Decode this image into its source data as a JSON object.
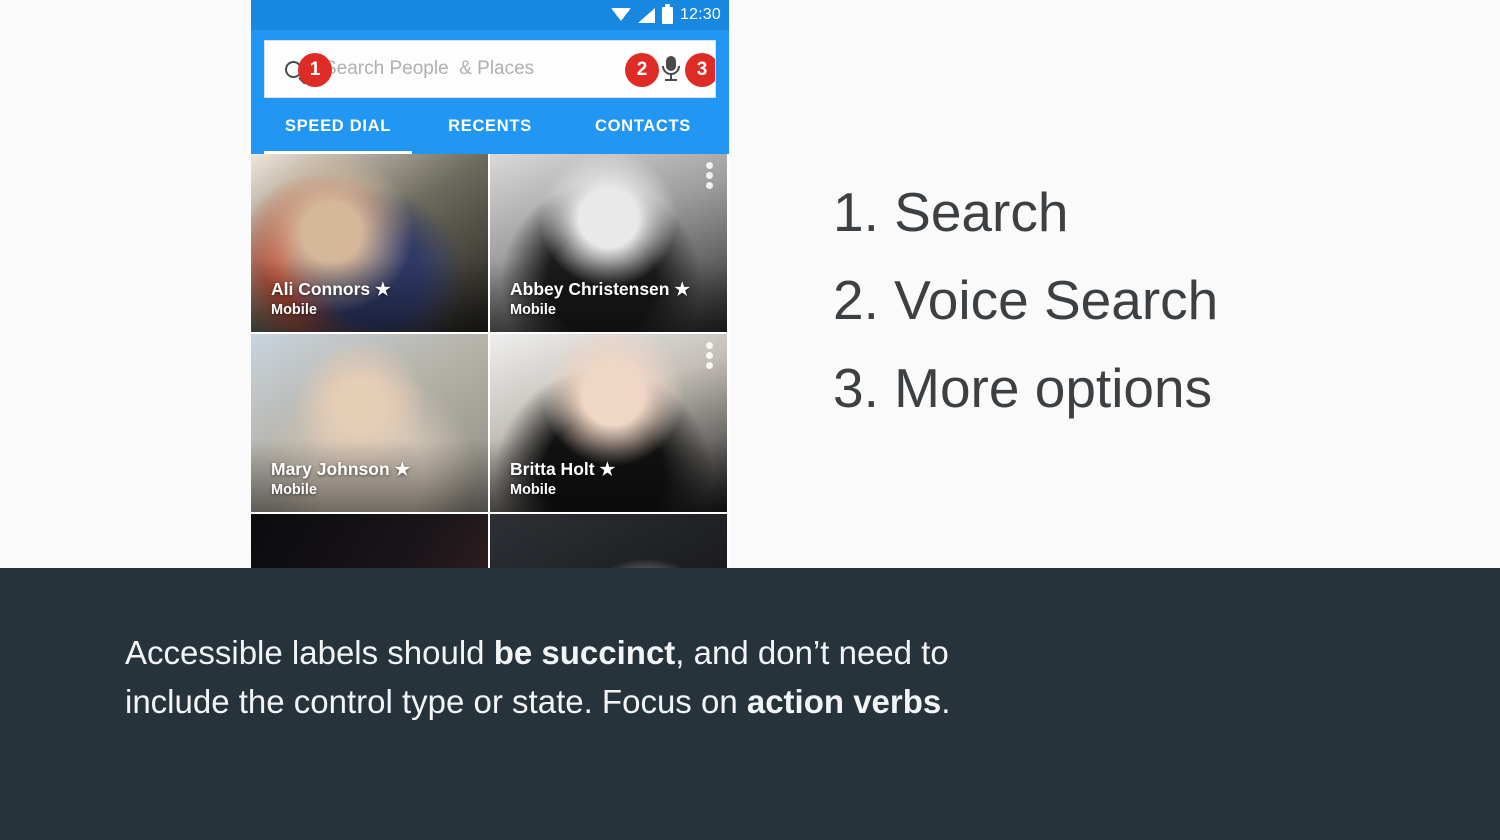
{
  "page": {
    "background_color": "#fafafa"
  },
  "phone": {
    "status_bar": {
      "time": "12:30",
      "icons": [
        "wifi-icon",
        "cellular-signal-icon",
        "battery-icon"
      ],
      "background_color": "#1787e0"
    },
    "search": {
      "placeholder": "Search People  & Places",
      "search_icon": "search-icon",
      "voice_icon": "microphone-icon",
      "overflow_icon": "more-vert-icon",
      "background_color": "#2196f3",
      "field_background": "#fdfdfd"
    },
    "callout_badges": [
      {
        "number": "1",
        "target": "search-icon"
      },
      {
        "number": "2",
        "target": "microphone-icon"
      },
      {
        "number": "3",
        "target": "more-vert-icon"
      }
    ],
    "badge_color": "#df2b25",
    "tabs": [
      {
        "label": "SPEED DIAL",
        "selected": true
      },
      {
        "label": "RECENTS",
        "selected": false
      },
      {
        "label": "CONTACTS",
        "selected": false
      }
    ],
    "contacts": [
      {
        "name": "Ali Connors",
        "starred": true,
        "subtitle": "Mobile",
        "star": "★",
        "has_overflow": false
      },
      {
        "name": "Abbey Christensen",
        "starred": true,
        "subtitle": "Mobile",
        "star": "★",
        "has_overflow": true
      },
      {
        "name": "Mary Johnson",
        "starred": true,
        "subtitle": "Mobile",
        "star": "★",
        "has_overflow": false
      },
      {
        "name": "Britta Holt",
        "starred": true,
        "subtitle": "Mobile",
        "star": "★",
        "has_overflow": true
      }
    ]
  },
  "legend": {
    "items": [
      "1. Search",
      "2. Voice Search",
      "3. More options"
    ],
    "text_color": "#3c4043"
  },
  "footer": {
    "background_color": "#27333b",
    "caption_parts": [
      {
        "text": "Accessible labels should ",
        "bold": false
      },
      {
        "text": "be succinct",
        "bold": true
      },
      {
        "text": ", and don’t need to include the control type or state. Focus on ",
        "bold": false
      },
      {
        "text": "action verbs",
        "bold": true
      },
      {
        "text": ".",
        "bold": false
      }
    ]
  }
}
